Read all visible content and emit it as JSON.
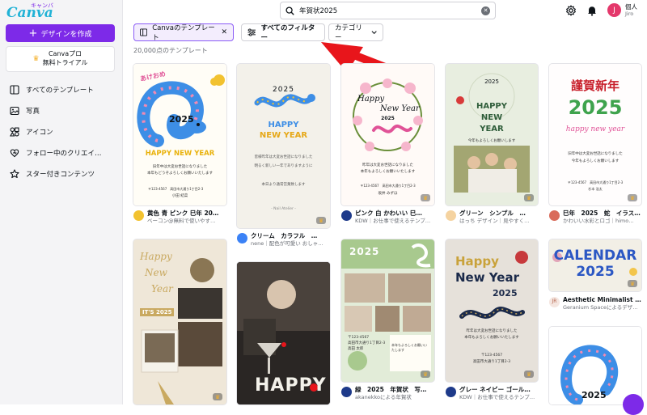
{
  "app": {
    "logo": "Canva",
    "logo_kana": "キャンバ"
  },
  "sidebar": {
    "create_label": "デザインを作成",
    "trial_line1": "Canvaプロ",
    "trial_line2": "無料トライアル",
    "items": [
      {
        "label": "すべてのテンプレート",
        "icon": "template-icon"
      },
      {
        "label": "写真",
        "icon": "photo-icon"
      },
      {
        "label": "アイコン",
        "icon": "shapes-icon"
      },
      {
        "label": "フォロー中のクリエイ…",
        "icon": "follow-icon"
      },
      {
        "label": "スター付きコンテンツ",
        "icon": "star-icon"
      }
    ]
  },
  "search": {
    "query": "年賀状2025"
  },
  "account": {
    "initial": "J",
    "line1": "個人",
    "line2": "Jiro"
  },
  "filters": {
    "active_chip": "Canvaのテンプレート",
    "all_filters": "すべてのフィルター",
    "category": "カテゴリー"
  },
  "results_count": "20,000点のテンプレート",
  "cards": [
    {
      "title": "黄色 青 ピンク 巳年 20…",
      "sub": "ベーコン@無料で使いやす…",
      "avatar_color": "#f2c230",
      "art": {
        "big": "2025",
        "text1": "あけおめ",
        "text2": "HAPPY NEW YEAR",
        "line1": "旧年中は大変お世話になりました",
        "line2": "本年もどうぞよろしくお願いいたします",
        "line3": "〒123-4567　高田市大通り1丁目2-3",
        "line4": "小田 結菜"
      }
    },
    {
      "title": "",
      "sub": "",
      "avatar_color": "#ffffff",
      "art": {
        "big": "2025",
        "text1": "HAPPY",
        "text2": "NEW YEAR",
        "line1": "皆様昨年は大変お世話になりました",
        "line2": "明るく新しい一年でありますように",
        "line3": "本日より通常営業致します",
        "line4": "- Nail Atelier -"
      }
    },
    {
      "title": "クリーム　カラフル　…",
      "sub": "nene｜配色が可愛い おしゃ…",
      "avatar_color": "#3b82f6",
      "art": {
        "big": "2025",
        "text1": "HAPPY",
        "text2": "NEW YEAR",
        "line1": "",
        "line2": "",
        "line3": "",
        "line4": ""
      }
    },
    {
      "title": "ピンク 白 かわいい 巳…",
      "sub": "KDW｜お仕事で使えるテンプ…",
      "avatar_color": "#1e3a8a",
      "art": {
        "big": "2025",
        "text1": "Happy",
        "text2": "New Year",
        "line1": "昨年は大変お世話になりました",
        "line2": "本年もよろしくお願いいたします",
        "line3": "〒123-4567　高田市大通り1丁目2-3",
        "line4": "坂井 みずほ"
      }
    },
    {
      "title": "グリーン　シンプル　…",
      "sub": "はっち デザイン｜見やすく…",
      "avatar_color": "#f5d3a0",
      "art": {
        "big": "2025",
        "text1": "HAPPY",
        "text2": "NEW",
        "text3": "YEAR",
        "line1": "今年もよろしくお願いします",
        "line2": "",
        "line3": "",
        "line4": ""
      }
    },
    {
      "title": "巳年　2025　蛇　イラス…",
      "sub": "かわいい水彩とロゴ｜himo…",
      "avatar_color": "#d96b5a",
      "art": {
        "big": "2025",
        "text1": "謹賀新年",
        "text2": "happy new year",
        "line1": "旧年中は大変お世話になりました",
        "line2": "今年もよろしくお願いします",
        "line3": "〒123-4567　高田市大通り1丁目2-3",
        "line4": "杉本 浩太"
      }
    },
    {
      "title": "",
      "sub": "",
      "avatar_color": "#ffffff",
      "art": {
        "big": "IT'S 2025",
        "text1": "Happy",
        "text2": "New",
        "text3": "Year"
      }
    },
    {
      "title": "",
      "sub": "",
      "avatar_color": "#ffffff",
      "art": {
        "big": "HAPPY"
      }
    },
    {
      "title": "緑　2025　年賀状　写…",
      "sub": "akanekkoによる年賀状",
      "avatar_color": "#1e3a8a",
      "art": {
        "big": "2025",
        "line1": "〒123-4567",
        "line2": "高田市大通り1丁目2-3",
        "line3": "高田 太郎",
        "line4": "本年もよろしくお願いいたします"
      }
    },
    {
      "title": "グレー ネイビー ゴール…",
      "sub": "KDW｜お仕事で使えるテンプ…",
      "avatar_color": "#1e3a8a",
      "art": {
        "big": "2025",
        "text1": "Happy",
        "text2": "New Year",
        "line1": "昨年は大変お世話になりました",
        "line2": "本年もよろしくお願いいたします",
        "line3": "〒123-4567",
        "line4": "高田市大通り1丁目2-3"
      }
    },
    {
      "title": "Aesthetic Minimalist …",
      "sub": "Geranium Spaceによるデザ…",
      "avatar_color": "#f5e6e0",
      "avatar_text": "JR",
      "art": {
        "big": "CALENDAR",
        "text1": "2025"
      }
    },
    {
      "title": "",
      "sub": "",
      "avatar_color": "#ffffff",
      "art": {
        "big": "2025"
      }
    }
  ],
  "colors": {
    "accent": "#7d2ae8",
    "arrow": "#e8151b"
  }
}
